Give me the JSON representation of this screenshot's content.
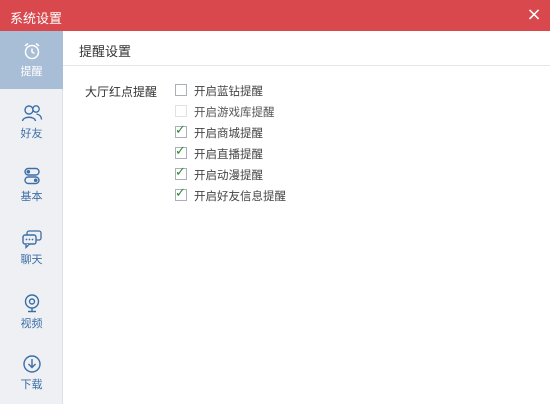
{
  "window": {
    "title": "系统设置",
    "close_glyph": "×"
  },
  "sidebar": {
    "items": [
      {
        "label": "提醒",
        "icon": "alarm-clock-icon",
        "active": true
      },
      {
        "label": "好友",
        "icon": "friends-icon",
        "active": false
      },
      {
        "label": "基本",
        "icon": "toggle-icon",
        "active": false
      },
      {
        "label": "聊天",
        "icon": "chat-icon",
        "active": false
      },
      {
        "label": "视频",
        "icon": "webcam-icon",
        "active": false
      },
      {
        "label": "下载",
        "icon": "download-icon",
        "active": false
      }
    ]
  },
  "main": {
    "section_title": "提醒设置",
    "group_label": "大厅红点提醒",
    "options": [
      {
        "label": "开启蓝钻提醒",
        "checked": false,
        "disabled": false
      },
      {
        "label": "开启游戏库提醒",
        "checked": false,
        "disabled": true
      },
      {
        "label": "开启商城提醒",
        "checked": true,
        "disabled": false
      },
      {
        "label": "开启直播提醒",
        "checked": true,
        "disabled": false
      },
      {
        "label": "开启动漫提醒",
        "checked": true,
        "disabled": false
      },
      {
        "label": "开启好友信息提醒",
        "checked": true,
        "disabled": false
      }
    ]
  },
  "colors": {
    "titlebar": "#d8484d",
    "sidebar_bg": "#eef0f3",
    "sidebar_active": "#a8bdd6",
    "icon_blue": "#3c6ea8",
    "check_green": "#2a8a3a"
  }
}
